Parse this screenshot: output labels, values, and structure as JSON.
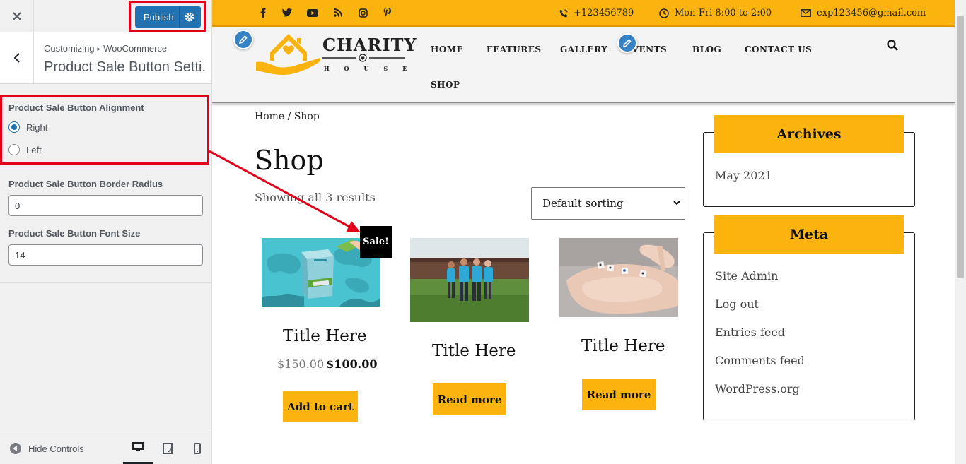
{
  "customizer": {
    "publish_label": "Publish",
    "breadcrumb": {
      "root": "Customizing",
      "section": "WooCommerce"
    },
    "section_title": "Product Sale Button Setti...",
    "controls": {
      "alignment": {
        "label": "Product Sale Button Alignment",
        "options": [
          {
            "label": "Right",
            "checked": true
          },
          {
            "label": "Left",
            "checked": false
          }
        ]
      },
      "border_radius": {
        "label": "Product Sale Button Border Radius",
        "value": "0"
      },
      "font_size": {
        "label": "Product Sale Button Font Size",
        "value": "14"
      }
    },
    "footer": {
      "hide_controls": "Hide Controls",
      "devices": [
        "desktop",
        "tablet",
        "mobile"
      ],
      "active_device": "desktop"
    }
  },
  "site": {
    "topbar": {
      "social_icons": [
        "facebook-icon",
        "twitter-icon",
        "youtube-icon",
        "rss-icon",
        "instagram-icon",
        "pinterest-icon"
      ],
      "phone": "+123456789",
      "hours": "Mon-Fri 8:00 to 2:00",
      "email": "exp123456@gmail.com"
    },
    "logo": {
      "name": "CHARITY",
      "sub": "HOUSE"
    },
    "nav": [
      "HOME",
      "FEATURES",
      "GALLERY",
      "EVENTS",
      "BLOG",
      "CONTACT US",
      "SHOP"
    ],
    "breadcrumb": "Home / Shop",
    "page_title": "Shop",
    "results_text": "Showing all 3 results",
    "sort_label": "Default sorting",
    "products": [
      {
        "title": "Title Here",
        "old_price": "$150.00",
        "price": "$100.00",
        "button": "Add to cart",
        "sale_badge": "Sale!"
      },
      {
        "title": "Title Here",
        "button": "Read more"
      },
      {
        "title": "Title Here",
        "button": "Read more"
      }
    ],
    "sidebar": {
      "archives": {
        "title": "Archives",
        "items": [
          "May 2021"
        ]
      },
      "meta": {
        "title": "Meta",
        "items": [
          "Site Admin",
          "Log out",
          "Entries feed",
          "Comments feed",
          "WordPress.org"
        ]
      }
    }
  },
  "colors": {
    "accent": "#fbb40e",
    "wp_blue": "#2271b1",
    "annotation_red": "#e3001b"
  }
}
